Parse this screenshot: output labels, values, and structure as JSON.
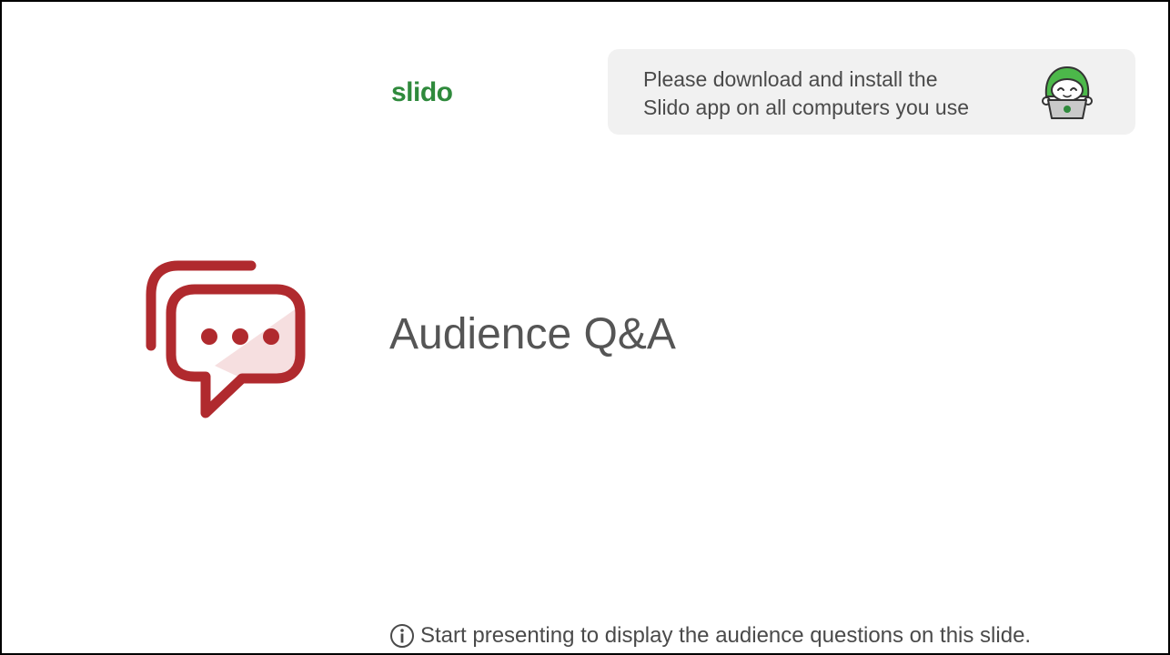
{
  "header": {
    "brand": "slido",
    "notice_line1": "Please download and install the",
    "notice_line2": "Slido app on all computers you use"
  },
  "main": {
    "title": "Audience Q&A"
  },
  "footer": {
    "hint": "Start presenting to display the audience questions on this slide."
  },
  "icons": {
    "brand_mascot": "slido-mascot-icon",
    "qa": "chat-bubbles-icon",
    "info": "info-icon"
  },
  "colors": {
    "brand_green": "#2f8a3c",
    "qa_red": "#b02a2e",
    "notice_bg": "#f1f1f1",
    "text_gray": "#555555"
  }
}
